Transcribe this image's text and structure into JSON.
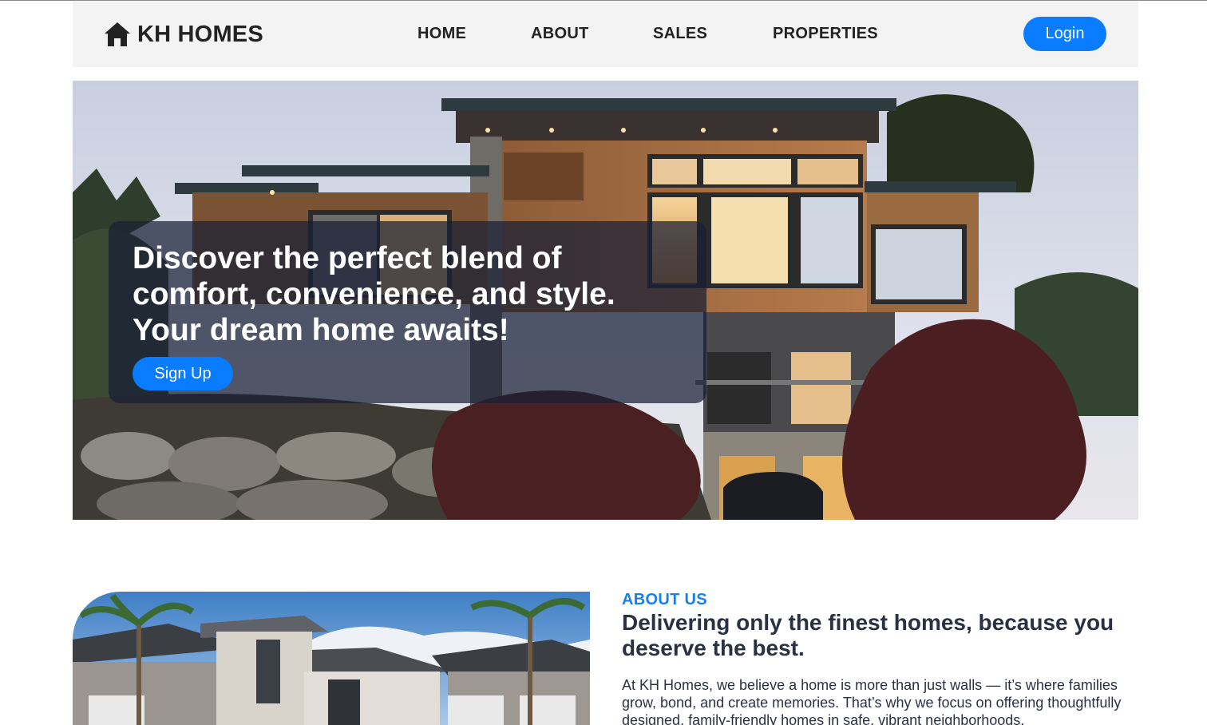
{
  "navbar": {
    "brand": "KH HOMES",
    "brand_icon": "home-icon",
    "links": [
      "HOME",
      "ABOUT",
      "SALES",
      "PROPERTIES"
    ],
    "login_label": "Login"
  },
  "hero": {
    "headline": "Discover the perfect blend of comfort, convenience, and style. Your dream home awaits!",
    "signup_label": "Sign Up"
  },
  "about": {
    "eyebrow": "ABOUT US",
    "heading": "Delivering only the finest homes, because you deserve the best.",
    "body": "At KH Homes, we believe a home is more than just walls — it’s where families grow, bond, and create memories. That’s why we focus on offering thoughtfully designed, family-friendly homes in safe, vibrant neighborhoods."
  },
  "colors": {
    "accent": "#0a7cff",
    "eyebrow": "#1a7fe8",
    "heading": "#2a3140",
    "navbar_bg": "#f3f3f3"
  }
}
